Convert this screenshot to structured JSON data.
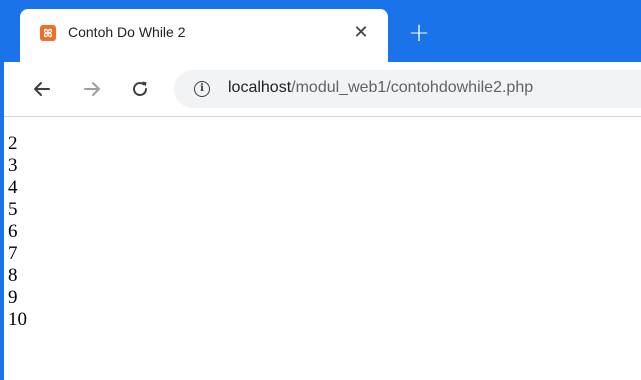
{
  "tab": {
    "title": "Contoh Do While 2",
    "favicon_text": "ꕤ"
  },
  "address_bar": {
    "host": "localhost",
    "path": "/modul_web1/contohdowhile2.php"
  },
  "output_lines": [
    "2",
    "3",
    "4",
    "5",
    "6",
    "7",
    "8",
    "9",
    "10"
  ],
  "colors": {
    "accent": "#1a73e8",
    "favicon": "#f26c2c"
  }
}
